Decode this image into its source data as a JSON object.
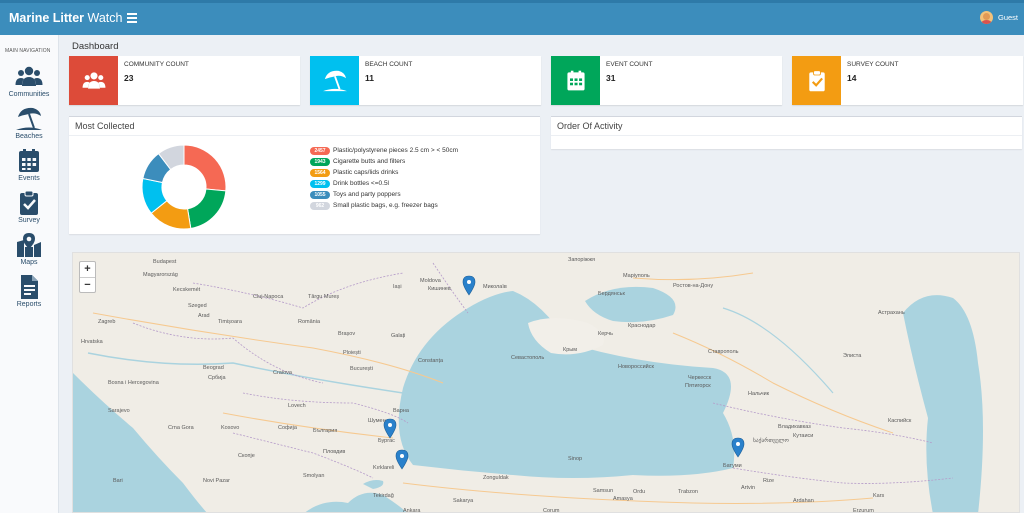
{
  "app": {
    "brand_bold": "Marine Litter",
    "brand_light": " Watch",
    "user": "Guest"
  },
  "sidebar": {
    "heading": "MAIN NAVIGATION",
    "items": [
      {
        "label": "Communities",
        "icon": "users-icon"
      },
      {
        "label": "Beaches",
        "icon": "umbrella-beach-icon"
      },
      {
        "label": "Events",
        "icon": "calendar-icon"
      },
      {
        "label": "Survey",
        "icon": "clipboard-check-icon"
      },
      {
        "label": "Maps",
        "icon": "map-marked-icon"
      },
      {
        "label": "Reports",
        "icon": "file-report-icon"
      }
    ]
  },
  "page": {
    "title": "Dashboard"
  },
  "stats": [
    {
      "label": "COMMUNITY COUNT",
      "value": "23",
      "color": "#dd4b39",
      "icon": "users-icon"
    },
    {
      "label": "BEACH COUNT",
      "value": "11",
      "color": "#00c0ef",
      "icon": "umbrella-beach-icon"
    },
    {
      "label": "EVENT COUNT",
      "value": "31",
      "color": "#00a65a",
      "icon": "calendar-icon"
    },
    {
      "label": "SURVEY COUNT",
      "value": "14",
      "color": "#f39c12",
      "icon": "clipboard-check-icon"
    }
  ],
  "most_collected": {
    "title": "Most Collected",
    "items": [
      {
        "count": "2457",
        "label": "Plastic/polystyrene pieces 2.5 cm > < 50cm",
        "value": 2457,
        "color": "#f56954"
      },
      {
        "count": "1943",
        "label": "Cigarette butts and filters",
        "value": 1943,
        "color": "#00a65a"
      },
      {
        "count": "1564",
        "label": "Plastic caps/lids drinks",
        "value": 1564,
        "color": "#f39c12"
      },
      {
        "count": "1299",
        "label": "Drink bottles <=0.5l",
        "value": 1299,
        "color": "#00c0ef"
      },
      {
        "count": "1055",
        "label": "Toys and party poppers",
        "value": 1055,
        "color": "#3c8dbc"
      },
      {
        "count": "962",
        "label": "Small plastic bags, e.g. freezer bags",
        "value": 962,
        "color": "#d2d6de"
      }
    ]
  },
  "activity": {
    "title": "Order Of Activity"
  },
  "map": {
    "zoom_in": "+",
    "zoom_out": "−",
    "labels": [
      "Budapest",
      "Magyarország",
      "Kecskemét",
      "Szeged",
      "Arad",
      "Cluj-Napoca",
      "Târgu Mureș",
      "Iași",
      "Кишинев",
      "Moldova",
      "Миколаїв",
      "Запоріжжя",
      "Маріуполь",
      "Бердянськ",
      "Ростов-на-Дону",
      "Zagreb",
      "Hrvatska",
      "Timișoara",
      "România",
      "Brașov",
      "Galați",
      "Ploiești",
      "București",
      "Constanța",
      "Beograd",
      "Србија",
      "Craiova",
      "Bosna i Hercegovina",
      "Sarajevo",
      "Crna Gora",
      "Kosovo",
      "Скопје",
      "Софија",
      "България",
      "Пловдив",
      "Бургас",
      "Варна",
      "Шумен",
      "Kırklareli",
      "Tekirdağ",
      "Sakarya",
      "Zonguldak",
      "Sinop",
      "Samsun",
      "Ordu",
      "Trabzon",
      "Amasya",
      "Севастополь",
      "Крым",
      "Керчь",
      "Новороссийск",
      "Краснодар",
      "Ставрополь",
      "Черкесск",
      "Пятигорск",
      "Нальчик",
      "Владикавказ",
      "Каспийск",
      "Астрахань",
      "Элиста",
      "Кутаиси",
      "საქართველო",
      "Батуми",
      "Rize",
      "Artvin",
      "Ardahan",
      "Kars",
      "Erzurum",
      "Ankara",
      "Çorum",
      "Bari",
      "Novi Pazar",
      "Lovech",
      "Smolyan"
    ],
    "markers": 4
  }
}
